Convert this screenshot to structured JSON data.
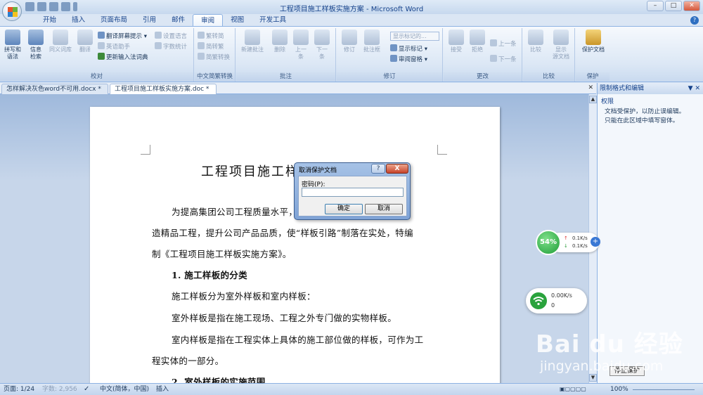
{
  "window": {
    "title": "工程项目施工样板实施方案 - Microsoft Word"
  },
  "ribbon_tabs": [
    "开始",
    "插入",
    "页面布局",
    "引用",
    "邮件",
    "审阅",
    "视图",
    "开发工具"
  ],
  "ribbon": {
    "proofing": {
      "spelling": "拼写和\n语法",
      "research": "信息\n检索",
      "thesaurus": "同义词库",
      "translate": "翻译",
      "translate_tip": "翻译屏幕提示",
      "en_assist": "英语助手",
      "update_ime": "更新输入法词典",
      "set_lang": "设置语言",
      "word_count": "字数统计",
      "label": "校对"
    },
    "chinese": {
      "to_trad": "繁转简",
      "to_simp": "简转繁",
      "convert": "简繁转换",
      "label": "中文简繁转换"
    },
    "comments": {
      "new": "新建批注",
      "delete": "删除",
      "prev": "上一\n条",
      "next": "下一\n条",
      "label": "批注"
    },
    "tracking": {
      "track": "修订",
      "balloons": "批注框",
      "display": "显示标记的...",
      "show_markup": "显示标记",
      "review_pane": "审阅窗格",
      "label": "修订"
    },
    "changes": {
      "accept": "接受",
      "reject": "拒绝",
      "prev": "上一条",
      "next": "下一条",
      "label": "更改"
    },
    "compare": {
      "compare": "比较",
      "show_source": "显示\n源文档",
      "label": "比较"
    },
    "protect": {
      "protect": "保护文档",
      "label": "保护"
    }
  },
  "doc_tabs": [
    "怎样解决灰色word不可用.docx *",
    "工程项目施工样板实施方案.doc *"
  ],
  "document": {
    "title": "工程项目施工样板实施方案",
    "lines": [
      "为提高集团公司工程质量水平，提高工程品质，努力打",
      "造精品工程，提升公司产品品质，使“样板引路”制落在实处，特编",
      "制《工程项目施工样板实施方案》。",
      "1. 施工样板的分类",
      "施工样板分为室外样板和室内样板：",
      "室外样板是指在施工现场、工程之外专门做的实物样板。",
      "室内样板是指在工程实体上具体的施工部位做的样板，可作为工",
      "程实体的一部分。",
      "2. 室外样板的实施范围"
    ]
  },
  "dialog": {
    "title": "取消保护文档",
    "help": "?",
    "close": "X",
    "label": "密码(P):",
    "password": "",
    "ok": "确定",
    "cancel": "取消"
  },
  "pane": {
    "title": "限制格式和编辑",
    "section": "权限",
    "text": "文档受保护，以防止误编辑。\n只能在此区域中填写窗体。",
    "stop": "停止保护"
  },
  "status": {
    "page": "页面: 1/24",
    "words": "字数: 2,956",
    "lang": "中文(简体，中国)",
    "mode": "插入",
    "zoom": "100%"
  },
  "widget": {
    "percent": "54%",
    "up": "0.1K/s",
    "down": "0.1K/s",
    "wifi_speed": "0.00K/s",
    "wifi_count": "0"
  },
  "watermark": {
    "logo": "Bai du 经验",
    "url": "jingyan.baidu.com"
  }
}
